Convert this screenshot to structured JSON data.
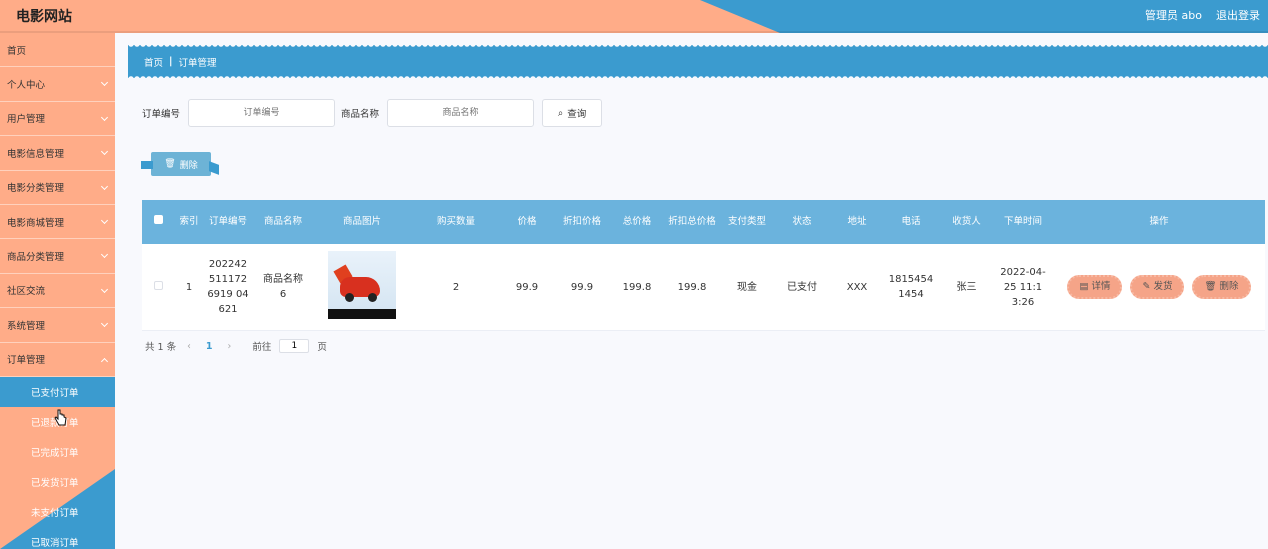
{
  "header": {
    "title": "电影网站",
    "admin": "管理员 abo",
    "logout": "退出登录"
  },
  "sidebar": {
    "items": [
      {
        "label": "首页",
        "expand": false
      },
      {
        "label": "个人中心",
        "expand": true
      },
      {
        "label": "用户管理",
        "expand": true
      },
      {
        "label": "电影信息管理",
        "expand": true
      },
      {
        "label": "电影分类管理",
        "expand": true
      },
      {
        "label": "电影商城管理",
        "expand": true
      },
      {
        "label": "商品分类管理",
        "expand": true
      },
      {
        "label": "社区交流",
        "expand": true
      },
      {
        "label": "系统管理",
        "expand": true
      },
      {
        "label": "订单管理",
        "expand": true
      }
    ],
    "sub_items": [
      "已支付订单",
      "已退款订单",
      "已完成订单",
      "已发货订单",
      "未支付订单",
      "已取消订单"
    ],
    "active_sub": "已支付订单"
  },
  "breadcrumb": {
    "home": "首页",
    "current": "订单管理"
  },
  "search": {
    "order_no_label": "订单编号",
    "order_no_placeholder": "订单编号",
    "product_label": "商品名称",
    "product_placeholder": "商品名称",
    "search_button": "查询"
  },
  "toolbar": {
    "delete_label": "删除"
  },
  "table": {
    "headers": [
      "索引",
      "订单编号",
      "商品名称",
      "商品图片",
      "购买数量",
      "价格",
      "折扣价格",
      "总价格",
      "折扣总价格",
      "支付类型",
      "状态",
      "地址",
      "电话",
      "收货人",
      "下单时间",
      "操作"
    ],
    "rows": [
      {
        "index": "1",
        "order_no": "2022425111726919 04621",
        "product": "商品名称6",
        "qty": "2",
        "price": "99.9",
        "discount_price": "99.9",
        "total": "199.8",
        "discount_total": "199.8",
        "pay_type": "现金",
        "status": "已支付",
        "address": "XXX",
        "phone": "18154541454",
        "receiver": "张三",
        "time": "2022-04-25 11:13:26"
      }
    ],
    "actions": {
      "detail": "详情",
      "ship": "发货",
      "delete": "删除"
    }
  },
  "pager": {
    "total": "共 1 条",
    "page": "1",
    "goto_label": "前往",
    "goto_value": "1",
    "page_suffix": "页"
  },
  "colors": {
    "blue": "#3b9bcf",
    "peach": "#ffac88",
    "header_blue": "#6bb3dd"
  }
}
